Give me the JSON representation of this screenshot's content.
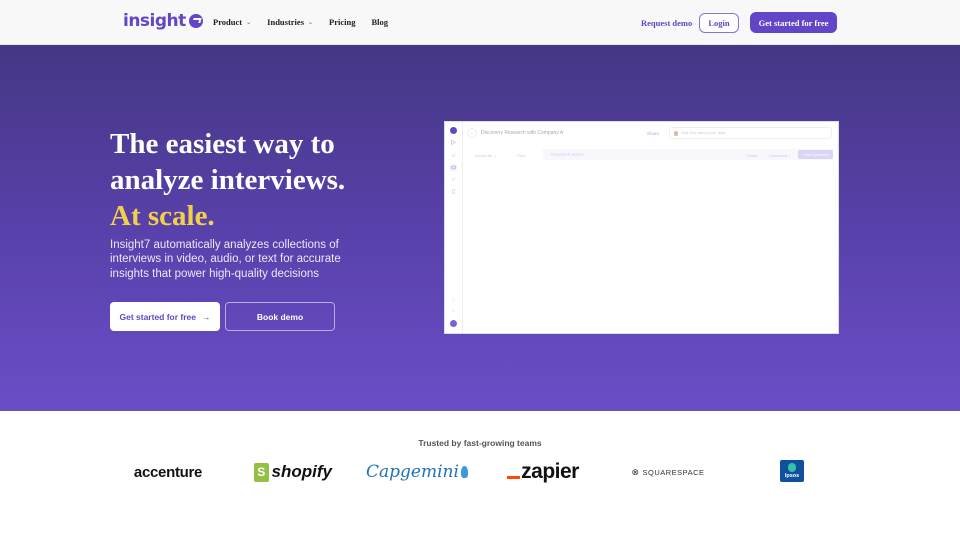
{
  "nav": {
    "logo": "insight",
    "links": [
      {
        "label": "Product",
        "dropdown": true
      },
      {
        "label": "Industries",
        "dropdown": true
      },
      {
        "label": "Pricing",
        "dropdown": false
      },
      {
        "label": "Blog",
        "dropdown": false
      }
    ],
    "request_demo": "Request demo",
    "login": "Login",
    "cta": "Get started for free"
  },
  "hero": {
    "title_line1": "The easiest way to",
    "title_line2": "analyze interviews.",
    "title_highlight": "At scale.",
    "subtitle": "Insight7 automatically analyzes collections of interviews in video, audio, or text for accurate insights that power high-quality decisions",
    "primary_button": "Get started for free",
    "primary_arrow": "→",
    "secondary_button": "Book demo",
    "colors": {
      "highlight": "#f2d14a",
      "brand": "#6246c6"
    }
  },
  "app_preview": {
    "back_icon": "←",
    "project_title": "Discovery Research with Company A",
    "share": "Share",
    "ask_placeholder": "Ask Sex about your data",
    "import_file": "Import file ⌄",
    "files": "Files",
    "tab": "Research Matrix",
    "share2": "Share",
    "download": "Download ⌄",
    "ask_question": "+ Ask Question"
  },
  "trusted": {
    "heading": "Trusted by fast-growing teams",
    "logos": [
      "accenture",
      "shopify",
      "Capgemini",
      "zapier",
      "SQUARESPACE",
      "Ipsos"
    ]
  }
}
